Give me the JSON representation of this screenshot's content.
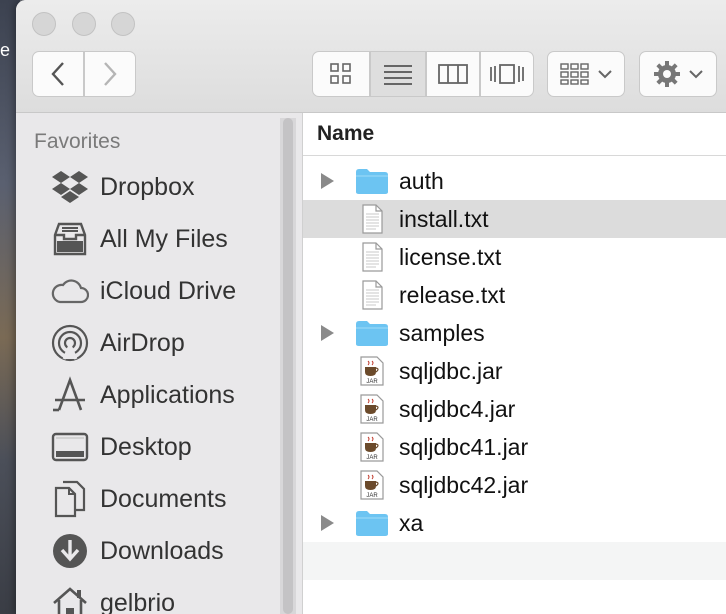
{
  "desktop": {
    "fragment": "e"
  },
  "sidebar": {
    "heading": "Favorites",
    "items": [
      {
        "label": "Dropbox",
        "icon": "dropbox-icon"
      },
      {
        "label": "All My Files",
        "icon": "all-my-files-icon"
      },
      {
        "label": "iCloud Drive",
        "icon": "cloud-icon"
      },
      {
        "label": "AirDrop",
        "icon": "airdrop-icon"
      },
      {
        "label": "Applications",
        "icon": "applications-icon"
      },
      {
        "label": "Desktop",
        "icon": "desktop-icon"
      },
      {
        "label": "Documents",
        "icon": "documents-icon"
      },
      {
        "label": "Downloads",
        "icon": "downloads-icon"
      },
      {
        "label": "gelbrio",
        "icon": "home-icon"
      }
    ]
  },
  "list": {
    "column_header": "Name",
    "rows": [
      {
        "name": "auth",
        "kind": "folder"
      },
      {
        "name": "install.txt",
        "kind": "text"
      },
      {
        "name": "license.txt",
        "kind": "text"
      },
      {
        "name": "release.txt",
        "kind": "text"
      },
      {
        "name": "samples",
        "kind": "folder"
      },
      {
        "name": "sqljdbc.jar",
        "kind": "jar"
      },
      {
        "name": "sqljdbc4.jar",
        "kind": "jar"
      },
      {
        "name": "sqljdbc41.jar",
        "kind": "jar"
      },
      {
        "name": "sqljdbc42.jar",
        "kind": "jar"
      },
      {
        "name": "xa",
        "kind": "folder"
      }
    ],
    "jar_badge": "JAR"
  },
  "colors": {
    "folder": "#6cc4f2",
    "selection": "#dcdcdc"
  }
}
